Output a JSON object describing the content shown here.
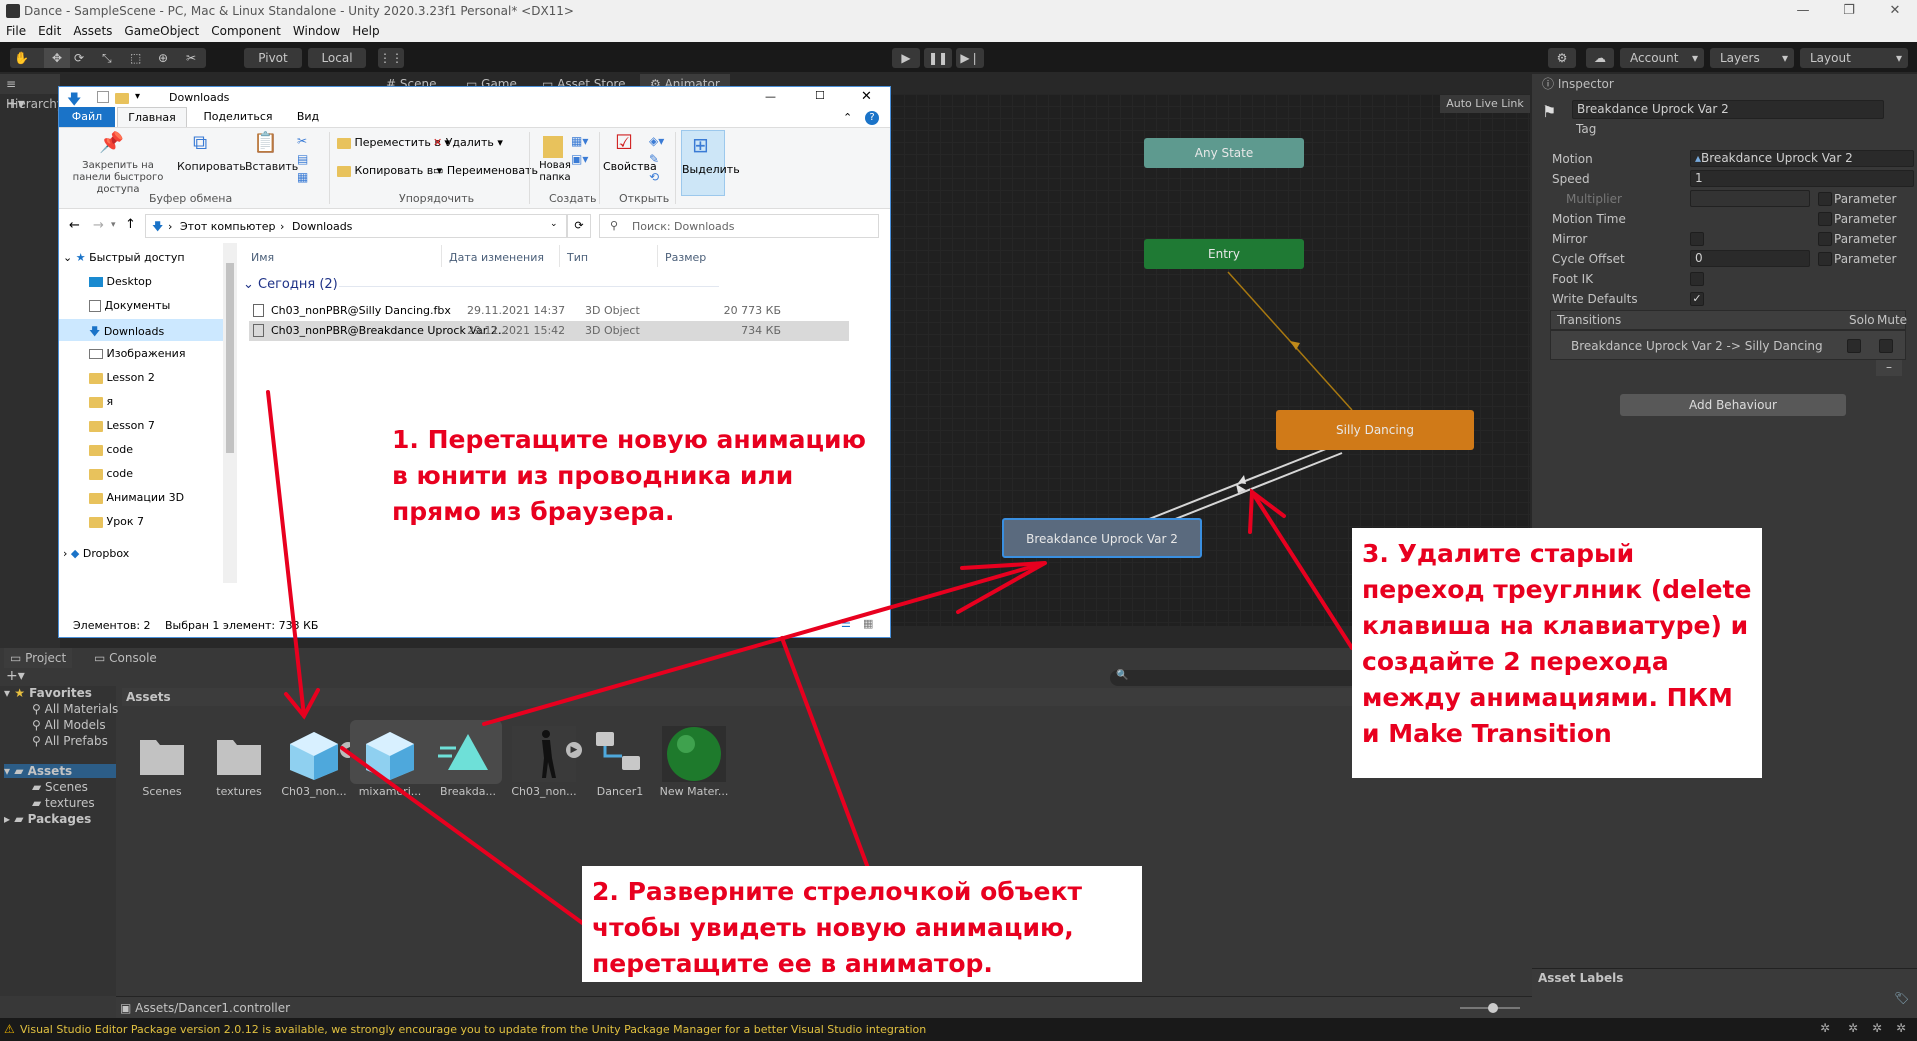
{
  "window": {
    "title": "Dance - SampleScene - PC, Mac & Linux Standalone - Unity 2020.3.23f1 Personal* <DX11>"
  },
  "menu": [
    "File",
    "Edit",
    "Assets",
    "GameObject",
    "Component",
    "Window",
    "Help"
  ],
  "toolbar": {
    "pivot": "Pivot",
    "local": "Local",
    "account": "Account",
    "layers": "Layers",
    "layout": "Layout"
  },
  "tabs": {
    "hierarchy": "Hierarchy",
    "scene": "Scene",
    "game": "Game",
    "asset_store": "Asset Store",
    "animator": "Animator",
    "inspector": "Inspector",
    "project": "Project",
    "console": "Console"
  },
  "animator": {
    "auto_live_link": "Auto Live Link",
    "states": {
      "any": "Any State",
      "entry": "Entry",
      "silly": "Silly Dancing",
      "breakdance": "Breakdance Uprock Var 2"
    }
  },
  "inspector": {
    "name": "Breakdance Uprock Var 2",
    "tag_label": "Tag",
    "rows": [
      {
        "label": "Motion",
        "value": "Breakdance Uprock Var 2"
      },
      {
        "label": "Speed",
        "value": "1"
      },
      {
        "label": "Multiplier",
        "value": ""
      },
      {
        "label": "Motion Time",
        "value": ""
      },
      {
        "label": "Mirror",
        "value": ""
      },
      {
        "label": "Cycle Offset",
        "value": "0"
      },
      {
        "label": "Foot IK",
        "value": ""
      },
      {
        "label": "Write Defaults",
        "value": ""
      }
    ],
    "parameter": "Parameter",
    "transitions_title": "Transitions",
    "solo": "Solo",
    "mute": "Mute",
    "transition": "Breakdance Uprock Var 2 -> Silly Dancing",
    "add_behaviour": "Add Behaviour",
    "asset_labels": "Asset Labels"
  },
  "explorer": {
    "title": "Downloads",
    "ribbon_tabs": [
      "Файл",
      "Главная",
      "Поделиться",
      "Вид"
    ],
    "ribbon": {
      "pin": "Закрепить на панели быстрого доступа",
      "copy": "Копировать",
      "paste": "Вставить",
      "clipboard_group": "Буфер обмена",
      "move_to": "Переместить в",
      "copy_to": "Копировать в",
      "delete": "Удалить",
      "rename": "Переименовать",
      "organize_group": "Упорядочить",
      "new_folder": "Новая папка",
      "create_group": "Создать",
      "properties": "Свойства",
      "open_group": "Открыть",
      "select": "Выделить"
    },
    "breadcrumb": [
      "Этот компьютер",
      "Downloads"
    ],
    "search_placeholder": "Поиск: Downloads",
    "nav": [
      "Быстрый доступ",
      "Desktop",
      "Документы",
      "Downloads",
      "Изображения",
      "Lesson 2",
      "я",
      "Lesson 7",
      "code",
      "code",
      "Анимации 3D",
      "Урок 7",
      "Dropbox"
    ],
    "columns": [
      "Имя",
      "Дата изменения",
      "Тип",
      "Размер"
    ],
    "group": "Сегодня (2)",
    "files": [
      {
        "name": "Ch03_nonPBR@Silly Dancing.fbx",
        "date": "29.11.2021 14:37",
        "type": "3D Object",
        "size": "20 773 КБ"
      },
      {
        "name": "Ch03_nonPBR@Breakdance Uprock Var 2...",
        "date": "29.11.2021 15:42",
        "type": "3D Object",
        "size": "734 КБ"
      }
    ],
    "status_items": "Элементов: 2",
    "status_selected": "Выбран 1 элемент: 733 КБ"
  },
  "project": {
    "favorites": "Favorites",
    "fav_items": [
      "All Materials",
      "All Models",
      "All Prefabs"
    ],
    "assets_root": "Assets",
    "asset_children": [
      "Scenes",
      "textures"
    ],
    "packages": "Packages",
    "header": "Assets",
    "items": [
      "Scenes",
      "textures",
      "Ch03_non...",
      "mixamori...",
      "Breakda...",
      "Ch03_non...",
      "Dancer1",
      "New Mater..."
    ],
    "path": "Assets/Dancer1.controller"
  },
  "notes": {
    "n1": "1. Перетащите новую анимацию в юнити из проводника или прямо из браузера.",
    "n2": "2. Разверните стрелочкой объект чтобы увидеть новую анимацию, перетащите ее в аниматор.",
    "n3": "3. Удалите старый переход треуглник (delete клавиша на клавиатуре) и создайте 2 перехода между анимациями. ПКМ и Make Transition"
  },
  "status_bar": "Visual Studio Editor Package version 2.0.12 is available, we strongly encourage you to update from the Unity Package Manager for a better Visual Studio integration",
  "colors": {
    "any_state": "#5e9a8f",
    "entry": "#1f7a34",
    "silly": "#d07a18",
    "breakdance": "#5a6a7e",
    "annotation": "#e8001f"
  }
}
